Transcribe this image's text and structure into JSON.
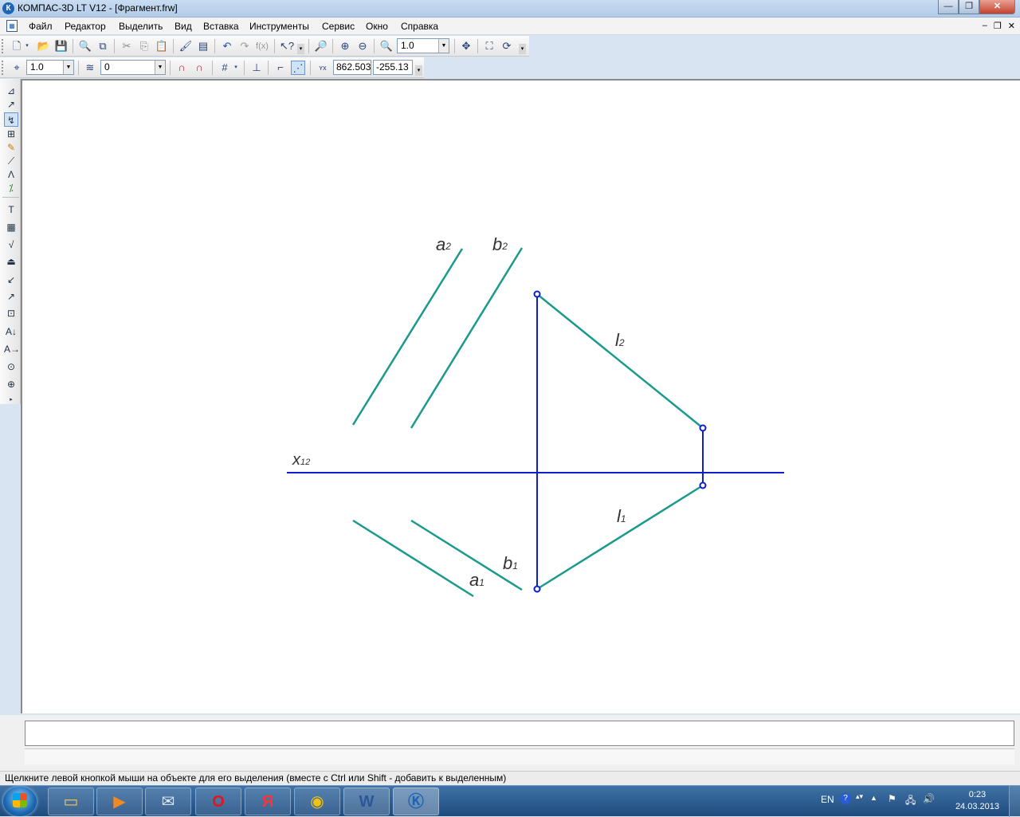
{
  "window": {
    "title": "КОМПАС-3D LT V12 - [Фрагмент.frw]",
    "app_icon": "К"
  },
  "menu": [
    "Файл",
    "Редактор",
    "Выделить",
    "Вид",
    "Вставка",
    "Инструменты",
    "Сервис",
    "Окно",
    "Справка"
  ],
  "toolbar1": {
    "zoom_value": "1.0",
    "fx_label": "f(x)"
  },
  "toolbar2": {
    "step_value": "1.0",
    "layer_value": "0",
    "coord_x": "862.503",
    "coord_y": "-255.13"
  },
  "drawing": {
    "labels": {
      "a2": "a",
      "a2_sub": "2",
      "b2": "b",
      "b2_sub": "2",
      "l2": "l",
      "l2_sub": "2",
      "x12": "x",
      "x12_sub": "12",
      "l1": "l",
      "l1_sub": "1",
      "b1": "b",
      "b1_sub": "1",
      "a1": "a",
      "a1_sub": "1"
    },
    "colors": {
      "teal": "#1a9a8c",
      "blue": "#0b1fcc",
      "label": "#333333"
    }
  },
  "status": {
    "hint": "Щелкните левой кнопкой мыши на объекте для его выделения (вместе с Ctrl или Shift - добавить к выделенным)"
  },
  "taskbar": {
    "apps": [
      "explorer-icon",
      "media-player-icon",
      "mail-icon",
      "opera-icon",
      "yandex-icon",
      "chrome-icon",
      "word-icon",
      "kompas-icon"
    ],
    "lang": "EN",
    "time": "0:23",
    "date": "24.03.2013"
  }
}
